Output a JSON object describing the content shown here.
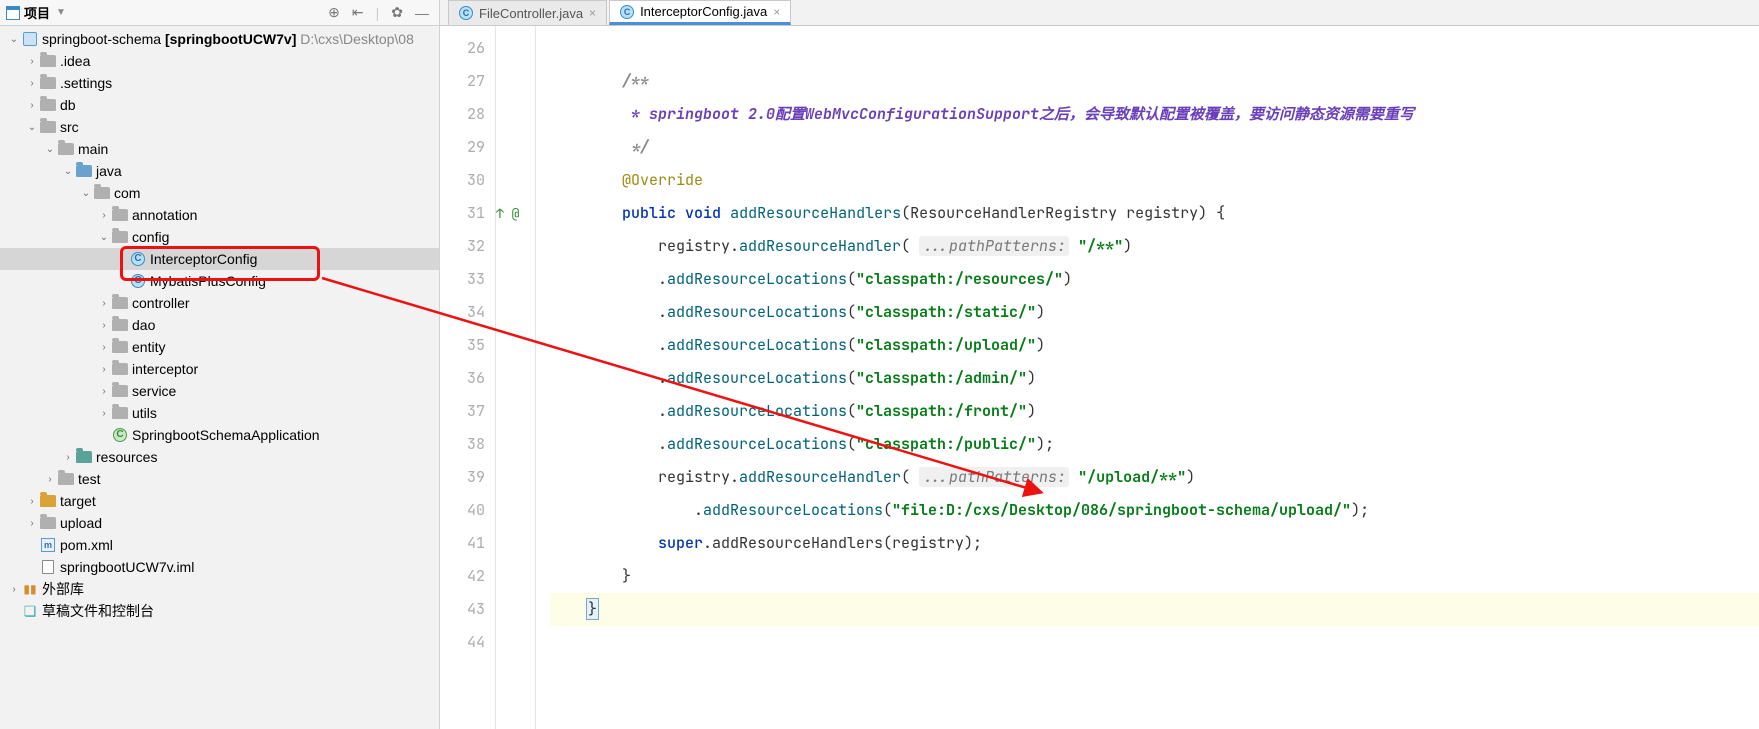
{
  "project_panel": {
    "title": "项目",
    "toolbar_icons": [
      "target-icon",
      "arrow-left-icon",
      "gear-icon",
      "hide-icon"
    ],
    "root": {
      "label_prefix": "springboot-schema",
      "label_bold": "[springbootUCW7v]",
      "path_dim": "D:\\cxs\\Desktop\\08"
    },
    "tree": [
      {
        "id": "root",
        "depth": 0,
        "arrow": "down",
        "icon": "module",
        "label": "__root__"
      },
      {
        "id": "idea",
        "depth": 1,
        "arrow": "right",
        "icon": "folder",
        "label": ".idea"
      },
      {
        "id": "settings",
        "depth": 1,
        "arrow": "right",
        "icon": "folder",
        "label": ".settings"
      },
      {
        "id": "db",
        "depth": 1,
        "arrow": "right",
        "icon": "folder",
        "label": "db"
      },
      {
        "id": "src",
        "depth": 1,
        "arrow": "down",
        "icon": "folder",
        "label": "src"
      },
      {
        "id": "main",
        "depth": 2,
        "arrow": "down",
        "icon": "folder",
        "label": "main"
      },
      {
        "id": "java",
        "depth": 3,
        "arrow": "down",
        "icon": "folder-blue",
        "label": "java"
      },
      {
        "id": "com",
        "depth": 4,
        "arrow": "down",
        "icon": "folder",
        "label": "com"
      },
      {
        "id": "annotation",
        "depth": 5,
        "arrow": "right",
        "icon": "folder",
        "label": "annotation"
      },
      {
        "id": "config",
        "depth": 5,
        "arrow": "down",
        "icon": "folder",
        "label": "config"
      },
      {
        "id": "interceptorconfig",
        "depth": 6,
        "arrow": "none",
        "icon": "class",
        "label": "InterceptorConfig",
        "selected": true
      },
      {
        "id": "mybatisplusconfig",
        "depth": 6,
        "arrow": "none",
        "icon": "class",
        "label": "MybatisPlusConfig"
      },
      {
        "id": "controller",
        "depth": 5,
        "arrow": "right",
        "icon": "folder",
        "label": "controller"
      },
      {
        "id": "dao",
        "depth": 5,
        "arrow": "right",
        "icon": "folder",
        "label": "dao"
      },
      {
        "id": "entity",
        "depth": 5,
        "arrow": "right",
        "icon": "folder",
        "label": "entity"
      },
      {
        "id": "interceptor",
        "depth": 5,
        "arrow": "right",
        "icon": "folder",
        "label": "interceptor"
      },
      {
        "id": "service",
        "depth": 5,
        "arrow": "right",
        "icon": "folder",
        "label": "service"
      },
      {
        "id": "utils",
        "depth": 5,
        "arrow": "right",
        "icon": "folder",
        "label": "utils"
      },
      {
        "id": "springapp",
        "depth": 5,
        "arrow": "none",
        "icon": "class-green",
        "label": "SpringbootSchemaApplication"
      },
      {
        "id": "resources",
        "depth": 3,
        "arrow": "right",
        "icon": "folder-teal",
        "label": "resources"
      },
      {
        "id": "test",
        "depth": 2,
        "arrow": "right",
        "icon": "folder",
        "label": "test"
      },
      {
        "id": "target",
        "depth": 1,
        "arrow": "right",
        "icon": "folder-gold",
        "label": "target"
      },
      {
        "id": "upload",
        "depth": 1,
        "arrow": "right",
        "icon": "folder",
        "label": "upload"
      },
      {
        "id": "pom",
        "depth": 1,
        "arrow": "none",
        "icon": "xml",
        "label": "pom.xml"
      },
      {
        "id": "iml",
        "depth": 1,
        "arrow": "none",
        "icon": "file",
        "label": "springbootUCW7v.iml"
      },
      {
        "id": "extlib",
        "depth": 0,
        "arrow": "right",
        "icon": "lib",
        "label": "外部库"
      },
      {
        "id": "scratch",
        "depth": 0,
        "arrow": "none",
        "icon": "scratch",
        "label": "草稿文件和控制台"
      }
    ]
  },
  "editor": {
    "tabs": [
      {
        "label": "FileController.java",
        "active": false
      },
      {
        "label": "InterceptorConfig.java",
        "active": true
      }
    ],
    "gutter_annotation_line": 31,
    "gutter_annotation_text": "↑ @",
    "line_numbers": [
      26,
      27,
      28,
      29,
      30,
      31,
      32,
      33,
      34,
      35,
      36,
      37,
      38,
      39,
      40,
      41,
      42,
      43,
      44
    ],
    "highlight_line": 43,
    "code": {
      "l27": "/**",
      "l28_prefix": " * springboot 2.0",
      "l28_zh": "配置WebMvcConfigurationSupport之后，会导致默认配置被覆盖，要访问静态资源需要重写",
      "l29": " */",
      "l30": "@Override",
      "l31_kw1": "public",
      "l31_kw2": "void",
      "l31_name": "addResourceHandlers",
      "l31_rest": "(ResourceHandlerRegistry registry) {",
      "l32_a": "registry.",
      "l32_m": "addResourceHandler",
      "l32_hint": "...pathPatterns:",
      "l32_s": "\"/**\"",
      "l33_m": "addResourceLocations",
      "l33_s": "\"classpath:/resources/\"",
      "l34_s": "\"classpath:/static/\"",
      "l35_s": "\"classpath:/upload/\"",
      "l36_s": "\"classpath:/admin/\"",
      "l37_s": "\"classpath:/front/\"",
      "l38_s": "\"classpath:/public/\"",
      "l39_a": "registry.",
      "l39_m": "addResourceHandler",
      "l39_hint": "...pathPatterns:",
      "l39_s": "\"/upload/**\"",
      "l40_m": "addResourceLocations",
      "l40_s": "\"file:D:/cxs/Desktop/086/springboot-schema/upload/\"",
      "l41_kw": "super",
      "l41_rest": ".addResourceHandlers(registry);",
      "l42": "}",
      "l43": "}"
    }
  }
}
